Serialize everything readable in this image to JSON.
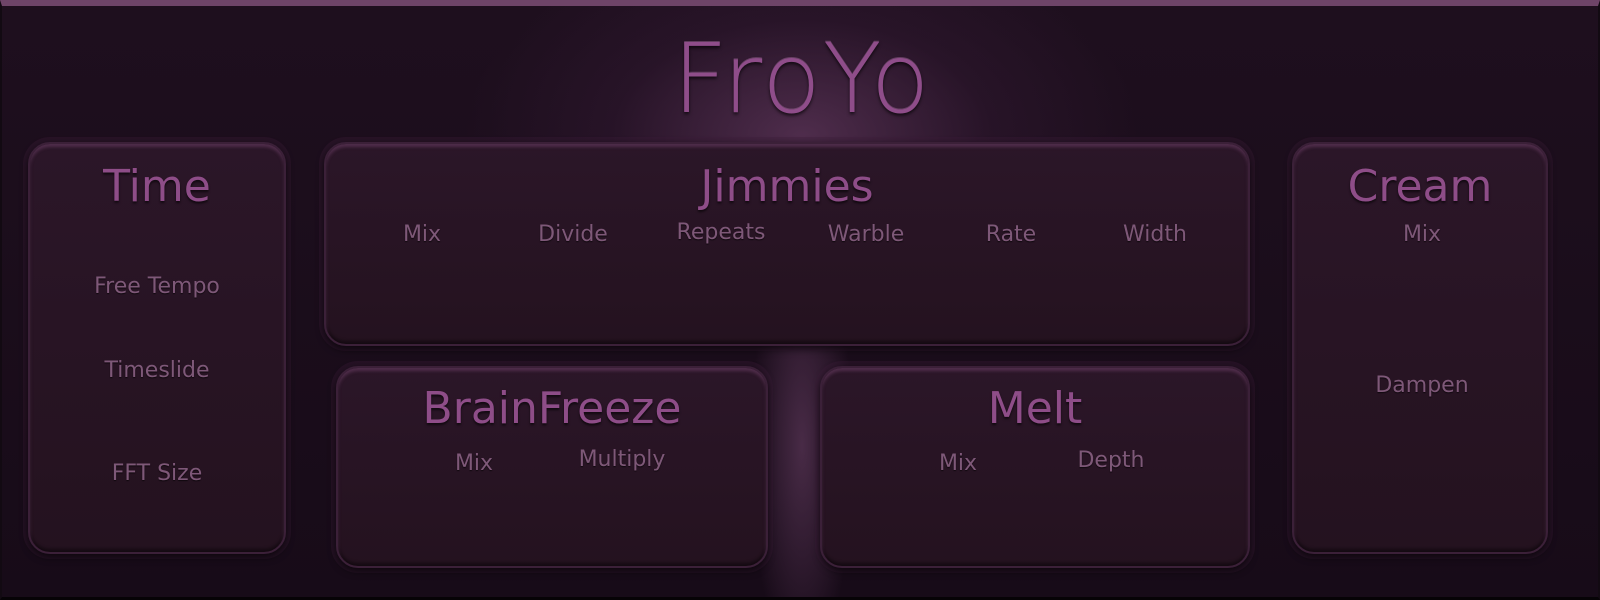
{
  "app": {
    "title": "FroYo"
  },
  "sections": {
    "time": {
      "title": "Time",
      "params": [
        "Free Tempo",
        "Timeslide",
        "FFT Size"
      ]
    },
    "jimmies": {
      "title": "Jimmies",
      "params": [
        "Mix",
        "Divide",
        "Repeats",
        "Warble",
        "Rate",
        "Width"
      ]
    },
    "cream": {
      "title": "Cream",
      "params": [
        "Mix",
        "Dampen"
      ]
    },
    "brainfreeze": {
      "title": "BrainFreeze",
      "params": [
        "Mix",
        "Multiply"
      ]
    },
    "melt": {
      "title": "Melt",
      "params": [
        "Mix",
        "Depth"
      ]
    }
  },
  "colors": {
    "background": "#1c0e1c",
    "panel": "#2a1527",
    "title_text": "#8f4d8a",
    "param_text": "#7e5878",
    "top_bar": "#6e4468"
  }
}
